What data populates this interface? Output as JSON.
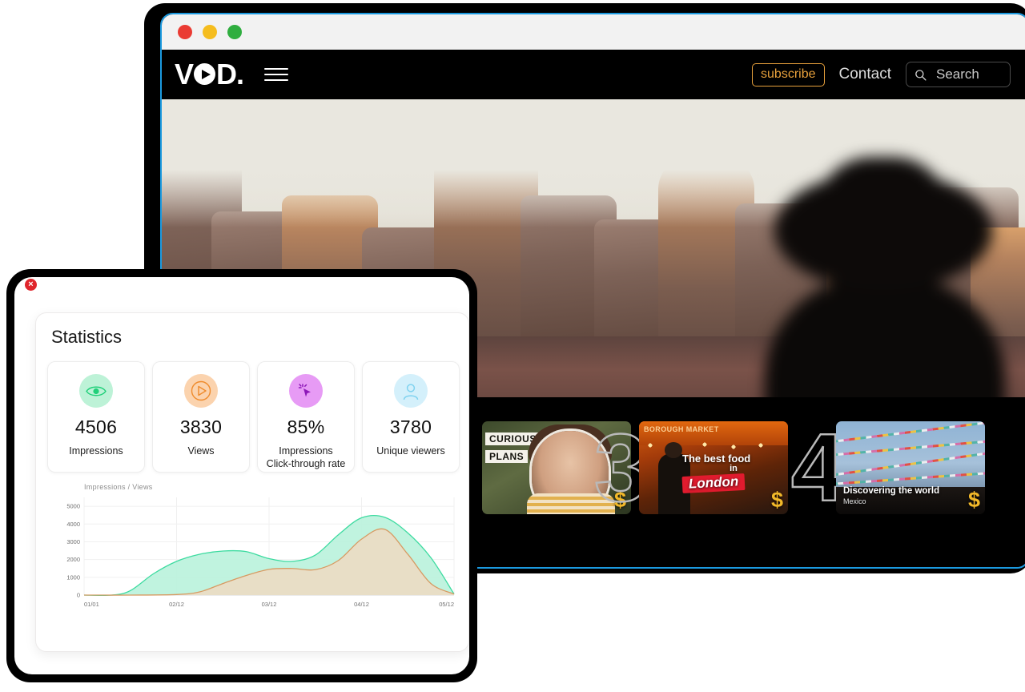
{
  "browser": {
    "traffic_lights": [
      "close",
      "minimize",
      "maximize"
    ],
    "nav": {
      "logo_v": "V",
      "logo_o": "O",
      "logo_d": "D.",
      "menu_icon": "hamburger-icon",
      "subscribe_label": "subscribe",
      "contact_label": "Contact",
      "search_placeholder": "Search",
      "search_value": "",
      "accent_color": "#e8a13c",
      "border_color": "#1b9ae0"
    },
    "hero": {
      "alt": "Desert rock formations at sunrise with a silhouetted person wearing a wide-brim hat"
    },
    "strip": {
      "items": [
        {
          "number": "",
          "title": "CURIOUS",
          "subtitle": "PLANS",
          "badge": "$"
        },
        {
          "number": "3",
          "title": "The best food",
          "in_word": "in",
          "place": "London",
          "market_sign": "BOROUGH MARKET",
          "badge": "$"
        },
        {
          "number": "4",
          "title": "Discovering the world",
          "subtitle": "Mexico",
          "badge": "$"
        }
      ]
    }
  },
  "stats_popup": {
    "close_glyph": "×",
    "title": "Statistics",
    "kpis": [
      {
        "icon": "eye-icon",
        "value": "4506",
        "label": "Impressions",
        "color": "#bdf2d7"
      },
      {
        "icon": "play-icon",
        "value": "3830",
        "label": "Views",
        "color": "#fbd3ae"
      },
      {
        "icon": "click-icon",
        "value": "85%",
        "label": "Impressions\nClick-through rate",
        "label_line1": "Impressions",
        "label_line2": "Click-through rate",
        "color": "#e79bf5"
      },
      {
        "icon": "user-icon",
        "value": "3780",
        "label": "Unique viewers",
        "color": "#d4f0fb"
      }
    ]
  },
  "chart_data": {
    "type": "area",
    "title": "Impressions / Views",
    "xlabel": "",
    "ylabel": "",
    "ylim": [
      0,
      5500
    ],
    "yticks": [
      0,
      1000,
      2000,
      3000,
      4000,
      5000
    ],
    "grid": true,
    "legend_position": "top-left",
    "categories": [
      "01/01",
      "02/12",
      "03/12",
      "04/12",
      "05/12"
    ],
    "x": [
      0,
      1,
      2,
      3,
      4
    ],
    "series": [
      {
        "name": "Impressions",
        "color": "#3ddba0",
        "fill": "#b9f2dc",
        "points_x": [
          0.0,
          0.3,
          0.5,
          0.75,
          1.0,
          1.25,
          1.5,
          1.75,
          2.0,
          2.25,
          2.5,
          2.75,
          3.0,
          3.25,
          3.5,
          3.75,
          4.0
        ],
        "values": [
          0,
          0,
          250,
          1200,
          1900,
          2300,
          2480,
          2450,
          2050,
          1900,
          2250,
          3400,
          4350,
          4380,
          3500,
          2100,
          60
        ]
      },
      {
        "name": "Views",
        "color": "#d79a62",
        "fill": "#ecdcc3",
        "points_x": [
          0.0,
          0.5,
          1.0,
          1.25,
          1.5,
          1.75,
          2.0,
          2.25,
          2.5,
          2.75,
          3.0,
          3.25,
          3.5,
          3.75,
          4.0
        ],
        "values": [
          0,
          0,
          30,
          180,
          650,
          1100,
          1450,
          1500,
          1430,
          1950,
          3150,
          3700,
          2300,
          650,
          60
        ]
      }
    ]
  }
}
